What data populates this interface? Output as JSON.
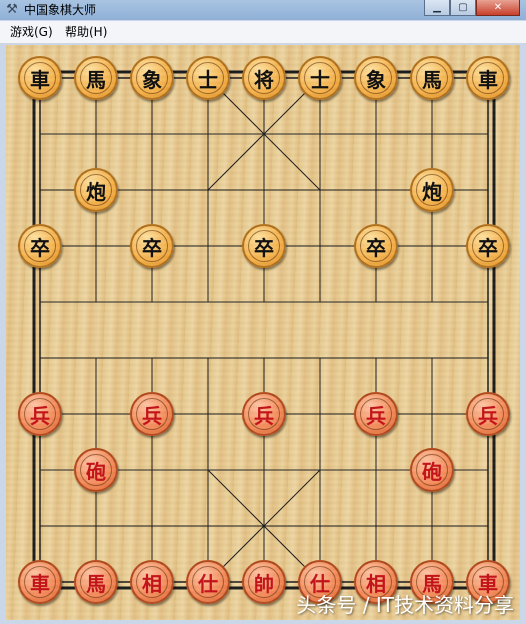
{
  "window": {
    "title": "中国象棋大师",
    "icon": "pipe-app-icon",
    "buttons": [
      "minimize",
      "maximize",
      "close"
    ]
  },
  "menubar": {
    "items": [
      "游戏(G)",
      "帮助(H)"
    ]
  },
  "board": {
    "files": 9,
    "ranks": 10,
    "colors": {
      "black_piece": "#f6b24a",
      "red_piece": "#f58a58",
      "red_text": "#c2141a",
      "lines": "#1a1a1a"
    },
    "pieces": [
      {
        "name": "black-chariot",
        "label": "車",
        "side": "black",
        "file": 0,
        "rank": 0
      },
      {
        "name": "black-horse",
        "label": "馬",
        "side": "black",
        "file": 1,
        "rank": 0
      },
      {
        "name": "black-elephant",
        "label": "象",
        "side": "black",
        "file": 2,
        "rank": 0
      },
      {
        "name": "black-advisor",
        "label": "士",
        "side": "black",
        "file": 3,
        "rank": 0
      },
      {
        "name": "black-general",
        "label": "将",
        "side": "black",
        "file": 4,
        "rank": 0
      },
      {
        "name": "black-advisor",
        "label": "士",
        "side": "black",
        "file": 5,
        "rank": 0
      },
      {
        "name": "black-elephant",
        "label": "象",
        "side": "black",
        "file": 6,
        "rank": 0
      },
      {
        "name": "black-horse",
        "label": "馬",
        "side": "black",
        "file": 7,
        "rank": 0
      },
      {
        "name": "black-chariot",
        "label": "車",
        "side": "black",
        "file": 8,
        "rank": 0
      },
      {
        "name": "black-cannon",
        "label": "炮",
        "side": "black",
        "file": 1,
        "rank": 2
      },
      {
        "name": "black-cannon",
        "label": "炮",
        "side": "black",
        "file": 7,
        "rank": 2
      },
      {
        "name": "black-soldier",
        "label": "卒",
        "side": "black",
        "file": 0,
        "rank": 3
      },
      {
        "name": "black-soldier",
        "label": "卒",
        "side": "black",
        "file": 2,
        "rank": 3
      },
      {
        "name": "black-soldier",
        "label": "卒",
        "side": "black",
        "file": 4,
        "rank": 3
      },
      {
        "name": "black-soldier",
        "label": "卒",
        "side": "black",
        "file": 6,
        "rank": 3
      },
      {
        "name": "black-soldier",
        "label": "卒",
        "side": "black",
        "file": 8,
        "rank": 3
      },
      {
        "name": "red-soldier",
        "label": "兵",
        "side": "red",
        "file": 0,
        "rank": 6
      },
      {
        "name": "red-soldier",
        "label": "兵",
        "side": "red",
        "file": 2,
        "rank": 6
      },
      {
        "name": "red-soldier",
        "label": "兵",
        "side": "red",
        "file": 4,
        "rank": 6
      },
      {
        "name": "red-soldier",
        "label": "兵",
        "side": "red",
        "file": 6,
        "rank": 6
      },
      {
        "name": "red-soldier",
        "label": "兵",
        "side": "red",
        "file": 8,
        "rank": 6
      },
      {
        "name": "red-cannon",
        "label": "砲",
        "side": "red",
        "file": 1,
        "rank": 7
      },
      {
        "name": "red-cannon",
        "label": "砲",
        "side": "red",
        "file": 7,
        "rank": 7
      },
      {
        "name": "red-chariot",
        "label": "車",
        "side": "red",
        "file": 0,
        "rank": 9
      },
      {
        "name": "red-horse",
        "label": "馬",
        "side": "red",
        "file": 1,
        "rank": 9
      },
      {
        "name": "red-elephant",
        "label": "相",
        "side": "red",
        "file": 2,
        "rank": 9
      },
      {
        "name": "red-advisor",
        "label": "仕",
        "side": "red",
        "file": 3,
        "rank": 9
      },
      {
        "name": "red-general",
        "label": "帥",
        "side": "red",
        "file": 4,
        "rank": 9
      },
      {
        "name": "red-advisor",
        "label": "仕",
        "side": "red",
        "file": 5,
        "rank": 9
      },
      {
        "name": "red-elephant",
        "label": "相",
        "side": "red",
        "file": 6,
        "rank": 9
      },
      {
        "name": "red-horse",
        "label": "馬",
        "side": "red",
        "file": 7,
        "rank": 9
      },
      {
        "name": "red-chariot",
        "label": "車",
        "side": "red",
        "file": 8,
        "rank": 9
      }
    ]
  },
  "watermark": "头条号 / IT技术资料分享"
}
